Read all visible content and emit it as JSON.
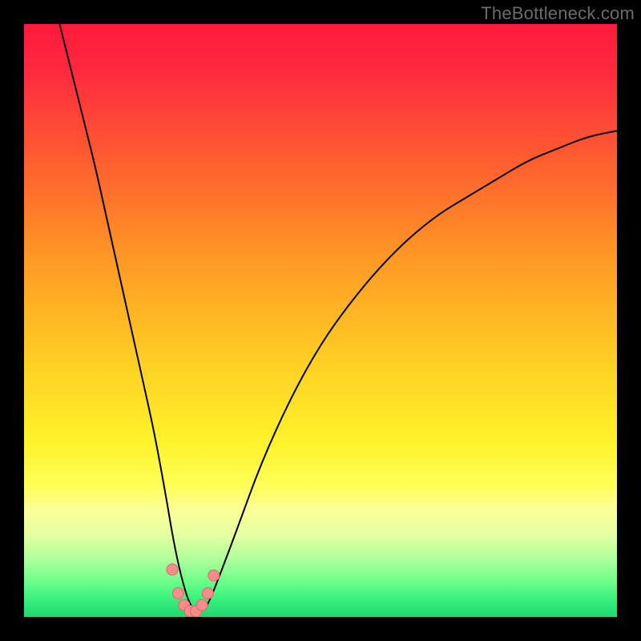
{
  "watermark": "TheBottleneck.com",
  "chart_data": {
    "type": "line",
    "title": "",
    "xlabel": "",
    "ylabel": "",
    "xlim": [
      0,
      100
    ],
    "ylim": [
      0,
      100
    ],
    "grid": false,
    "legend": false,
    "gradient_stops": [
      {
        "offset": 0.0,
        "color": "#ff1a3a"
      },
      {
        "offset": 0.07,
        "color": "#ff2740"
      },
      {
        "offset": 0.22,
        "color": "#ff5a30"
      },
      {
        "offset": 0.4,
        "color": "#ff9a24"
      },
      {
        "offset": 0.58,
        "color": "#ffd224"
      },
      {
        "offset": 0.7,
        "color": "#fff12a"
      },
      {
        "offset": 0.78,
        "color": "#feff5a"
      },
      {
        "offset": 0.82,
        "color": "#fcff9a"
      },
      {
        "offset": 0.86,
        "color": "#e6ffa0"
      },
      {
        "offset": 0.9,
        "color": "#b3ff9c"
      },
      {
        "offset": 0.94,
        "color": "#6cff8a"
      },
      {
        "offset": 0.97,
        "color": "#39f07d"
      },
      {
        "offset": 1.0,
        "color": "#1fd86f"
      }
    ],
    "series": [
      {
        "name": "bottleneck-curve",
        "color": "#000000",
        "x": [
          6,
          8,
          10,
          12,
          14,
          16,
          18,
          20,
          22,
          24,
          25,
          26,
          27,
          28,
          29,
          30,
          31,
          33,
          36,
          40,
          45,
          50,
          55,
          60,
          65,
          70,
          75,
          80,
          85,
          90,
          95,
          100
        ],
        "y": [
          100,
          92,
          84,
          76,
          67,
          58,
          49,
          40,
          31,
          20,
          14,
          9,
          5,
          2,
          1,
          1,
          2,
          7,
          15,
          26,
          37,
          46,
          53,
          59,
          64,
          68,
          71,
          74,
          77,
          79,
          81,
          82
        ]
      }
    ],
    "markers": {
      "name": "highlighted-points",
      "color": "#f98b8b",
      "stroke": "#d96a6a",
      "radius_px": 7,
      "points": [
        {
          "x": 25.0,
          "y": 8
        },
        {
          "x": 26.0,
          "y": 4
        },
        {
          "x": 27.0,
          "y": 2
        },
        {
          "x": 28.0,
          "y": 1
        },
        {
          "x": 29.0,
          "y": 1
        },
        {
          "x": 30.0,
          "y": 2
        },
        {
          "x": 31.0,
          "y": 4
        },
        {
          "x": 32.0,
          "y": 7
        }
      ]
    }
  }
}
